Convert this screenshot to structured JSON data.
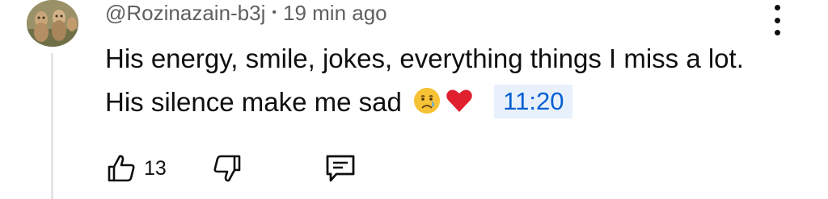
{
  "comment": {
    "author": "@Rozinazain-b3j",
    "separator": "•",
    "time_ago": "19 min ago",
    "text": "His energy, smile, jokes, everything things I miss a lot. His silence make me sad",
    "emojis": [
      "crying-face",
      "red-heart"
    ],
    "timestamp_link": "11:20",
    "like_count": "13"
  },
  "colors": {
    "meta_text": "#606060",
    "link": "#065fd4",
    "link_background": "#e8f1fb",
    "heart": "#e0202f"
  },
  "icons": {
    "menu": "vertical-dots-icon",
    "like": "thumbs-up-icon",
    "dislike": "thumbs-down-icon",
    "reply": "comment-icon"
  }
}
